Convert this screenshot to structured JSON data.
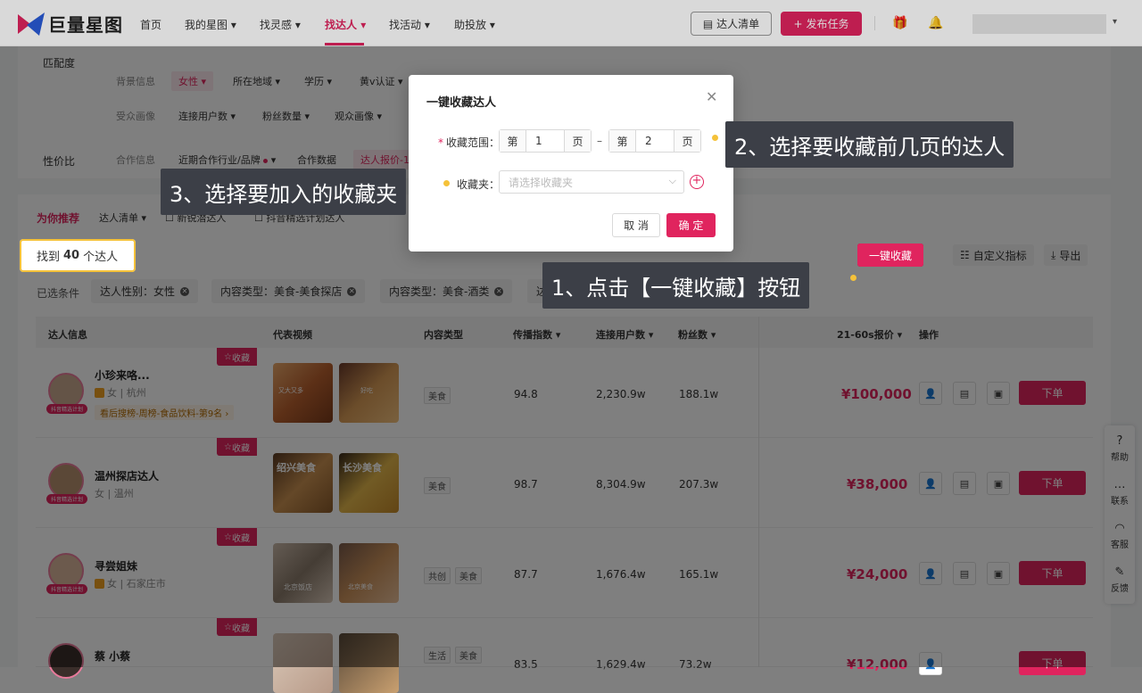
{
  "nav": {
    "logo": "巨量星图",
    "items": [
      "首页",
      "我的星图",
      "找灵感",
      "找达人",
      "找活动",
      "助投放"
    ],
    "list_btn": "达人清单",
    "publish_btn": "发布任务"
  },
  "filters": {
    "match_label": "匹配度",
    "value_label": "性价比",
    "row1": [
      "背景信息",
      "女性",
      "所在地域",
      "学历",
      "黄v认证"
    ],
    "row2": [
      "受众画像",
      "连接用户数",
      "粉丝数量",
      "观众画像"
    ],
    "row3": [
      "合作信息",
      "近期合作行业/品牌",
      "合作数据",
      "达人报价-1"
    ]
  },
  "list": {
    "recommend": "为你推荐",
    "list_dropdown": "达人清单",
    "check1": "新锐潜达人",
    "check2": "抖音精选计划达人",
    "found_prefix": "找到",
    "found_count": "40",
    "found_suffix": "个达人",
    "collect_all": "一键收藏",
    "custom_metrics": "自定义指标",
    "export": "导出",
    "chips_label": "已选条件",
    "chips": [
      "达人性别：女性",
      "内容类型：美食-美食探店",
      "内容类型：美食-酒类",
      "达"
    ]
  },
  "table": {
    "headers": [
      "达人信息",
      "代表视频",
      "内容类型",
      "传播指数",
      "连接用户数",
      "粉丝数",
      "21-60s报价",
      "操作"
    ],
    "collect_tag": "收藏",
    "order_btn": "下单",
    "avatar_tag": "抖音精选计划",
    "rows": [
      {
        "name": "小珍来咯...",
        "sub": "女 | 杭州",
        "rank": "看后搜榜-周榜-食品饮料-第9名 ›",
        "types": [
          "美食"
        ],
        "index": "94.8",
        "users": "2,230.9w",
        "fans": "188.1w",
        "price": "¥100,000",
        "v1": "又大又多",
        "v2": "好吃"
      },
      {
        "name": "温州探店达人",
        "sub": "女 | 温州",
        "rank": "",
        "types": [
          "美食"
        ],
        "index": "98.7",
        "users": "8,304.9w",
        "fans": "207.3w",
        "price": "¥38,000",
        "v1": "绍兴美食",
        "v2": "长沙美食"
      },
      {
        "name": "寻尝姐妹",
        "sub": "女 | 石家庄市",
        "rank": "",
        "types": [
          "共创",
          "美食"
        ],
        "index": "87.7",
        "users": "1,676.4w",
        "fans": "165.1w",
        "price": "¥24,000",
        "v1": "北京饭店",
        "v2": "北京美食"
      },
      {
        "name": "蔡 小蔡",
        "sub": "",
        "rank": "",
        "types": [
          "生活",
          "美食"
        ],
        "index": "83.5",
        "users": "1,629.4w",
        "fans": "73.2w",
        "price": "¥12,000",
        "v1": "",
        "v2": ""
      }
    ]
  },
  "side": [
    "帮助",
    "联系",
    "客服",
    "反馈"
  ],
  "dialog": {
    "title": "一键收藏达人",
    "range_label": "收藏范围",
    "page_pre": "第",
    "page_suf": "页",
    "from": "1",
    "to": "2",
    "folder_label": "收藏夹",
    "folder_placeholder": "请选择收藏夹",
    "cancel": "取 消",
    "ok": "确 定"
  },
  "callouts": {
    "c1": "1、点击【一键收藏】按钮",
    "c2": "2、选择要收藏前几页的达人",
    "c3": "3、选择要加入的收藏夹"
  },
  "colors": {
    "brand": "#e0245e",
    "highlight": "#f5c23a",
    "callout_bg": "#3c3f47"
  }
}
